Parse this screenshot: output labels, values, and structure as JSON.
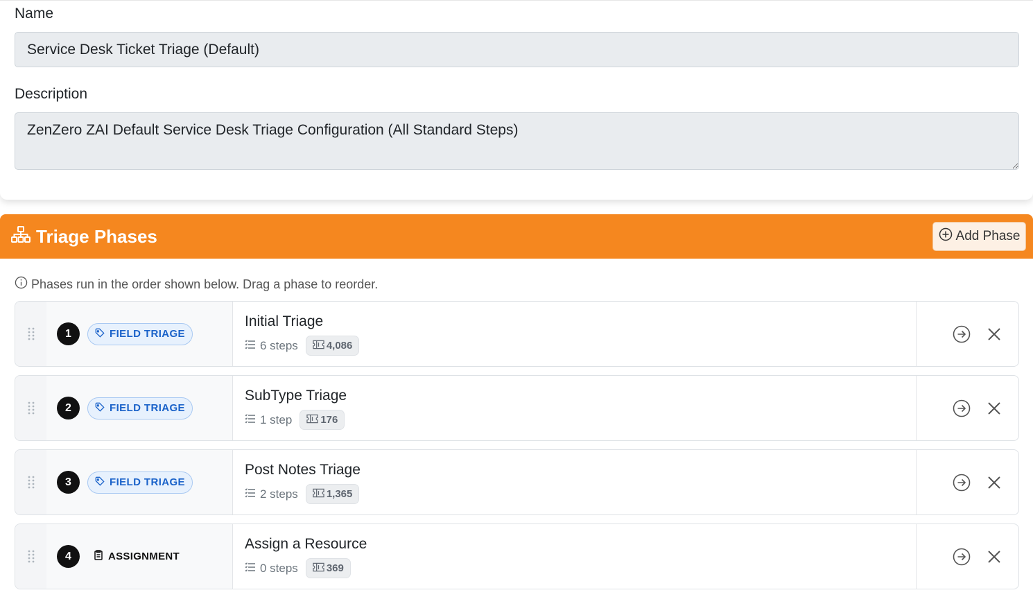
{
  "form": {
    "name_label": "Name",
    "name_value": "Service Desk Ticket Triage (Default)",
    "description_label": "Description",
    "description_value": "ZenZero ZAI Default Service Desk Triage Configuration (All Standard Steps)"
  },
  "phases_header": {
    "title": "Triage Phases",
    "title_icon": "sitemap-icon",
    "add_button_label": "Add Phase",
    "add_button_icon": "plus-circle-icon",
    "accent_color": "#f5871f"
  },
  "hint": {
    "text": "Phases run in the order shown below. Drag a phase to reorder.",
    "icon": "info-circle-icon"
  },
  "phases": [
    {
      "order": "1",
      "type": "FIELD TRIAGE",
      "type_icon": "tag-icon",
      "name": "Initial Triage",
      "steps": "6 steps",
      "tokens": "4,086"
    },
    {
      "order": "2",
      "type": "FIELD TRIAGE",
      "type_icon": "tag-icon",
      "name": "SubType Triage",
      "steps": "1 step",
      "tokens": "176"
    },
    {
      "order": "3",
      "type": "FIELD TRIAGE",
      "type_icon": "tag-icon",
      "name": "Post Notes Triage",
      "steps": "2 steps",
      "tokens": "1,365"
    },
    {
      "order": "4",
      "type": "ASSIGNMENT",
      "type_icon": "clipboard-icon",
      "name": "Assign a Resource",
      "steps": "0 steps",
      "tokens": "369"
    }
  ]
}
